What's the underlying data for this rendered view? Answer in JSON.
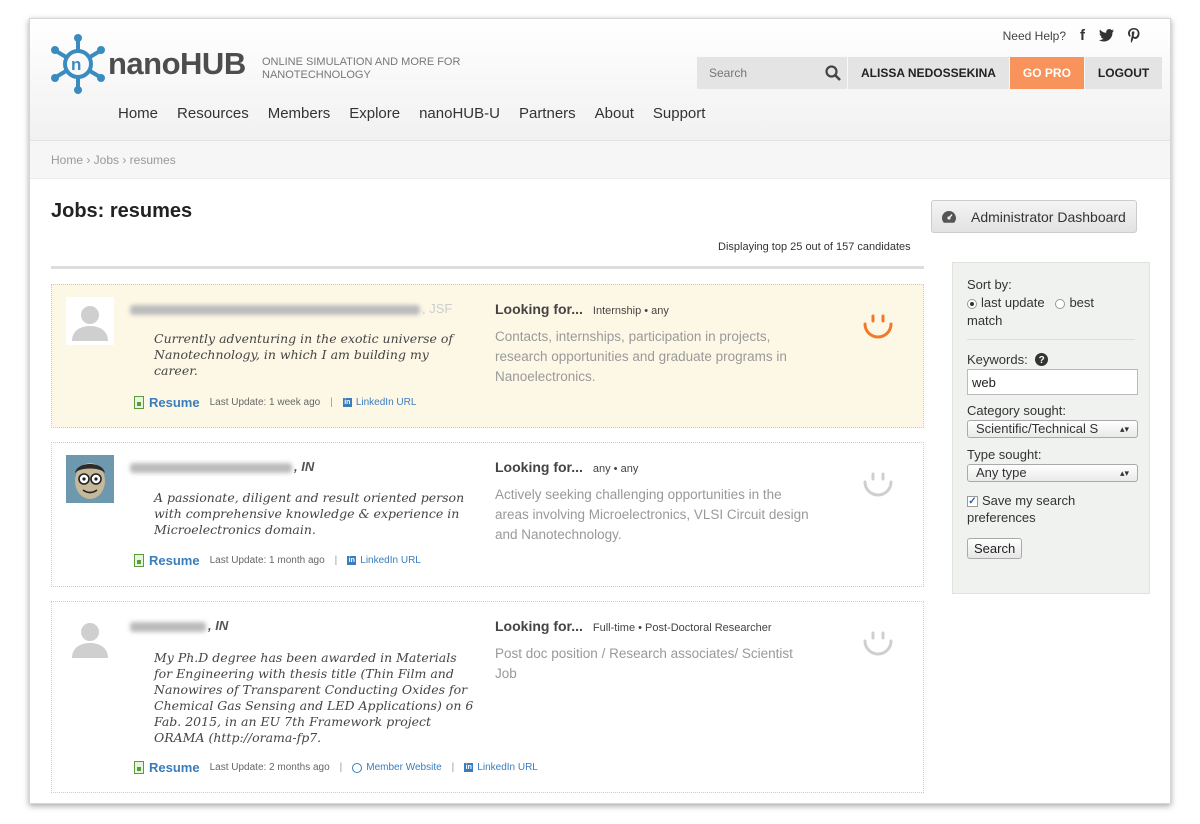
{
  "header": {
    "logo_text": "nanoHUB",
    "tagline": "ONLINE SIMULATION AND MORE FOR NANOTECHNOLOGY",
    "help_label": "Need Help?",
    "social": [
      "f",
      "t",
      "p"
    ],
    "search_placeholder": "Search",
    "user_name": "ALISSA NEDOSSEKINA",
    "gopro_label": "GO PRO",
    "logout_label": "LOGOUT",
    "accent_color": "#f7935b",
    "logo_color": "#3a8bc0"
  },
  "nav": [
    "Home",
    "Resources",
    "Members",
    "Explore",
    "nanoHUB-U",
    "Partners",
    "About",
    "Support"
  ],
  "breadcrumb": "Home › Jobs › resumes",
  "page_title": "Jobs: resumes",
  "admin_button": "Administrator Dashboard",
  "display_count": "Displaying top 25 out of 157 candidates",
  "candidates": [
    {
      "name_suffix": ", JSF",
      "bio": "Currently adventuring in the exotic universe of Nanotechnology, in which I am building my career.",
      "resume_label": "Resume",
      "last_update": "Last Update: 1 week ago",
      "linkedin_label": "LinkedIn URL",
      "looking_label": "Looking for...",
      "looking_type": "Internship • any",
      "description": "Contacts, internships, participation in projects, research opportunities and graduate programs in Nanoelectronics.",
      "smile_icon": "smile-active-icon"
    },
    {
      "name_suffix": ", IN",
      "bio": "A passionate, diligent and result oriented person with comprehensive knowledge & experience in Microelectronics domain.",
      "resume_label": "Resume",
      "last_update": "Last Update: 1 month ago",
      "linkedin_label": "LinkedIn URL",
      "looking_label": "Looking for...",
      "looking_type": "any • any",
      "description": "Actively seeking challenging opportunities in the areas involving Microelectronics, VLSI Circuit design and Nanotechnology.",
      "smile_icon": "smile-inactive-icon"
    },
    {
      "name_suffix": ", IN",
      "bio": "My Ph.D degree has been awarded in Materials for Engineering with thesis title (Thin Film and Nanowires of Transparent Conducting Oxides for Chemical Gas Sensing and LED Applications) on 6 Fab. 2015, in an EU 7th Framework project ORAMA (http://orama-fp7.",
      "resume_label": "Resume",
      "last_update": "Last Update: 2 months ago",
      "website_label": "Member Website",
      "linkedin_label": "LinkedIn URL",
      "looking_label": "Looking for...",
      "looking_type": "Full-time • Post-Doctoral Researcher",
      "description": "Post doc position / Research associates/ Scientist Job",
      "smile_icon": "smile-inactive-icon"
    }
  ],
  "sidebar": {
    "sort_label": "Sort by:",
    "sort_last_update": "last update",
    "sort_best": "best",
    "sort_best_2": "match",
    "keywords_label": "Keywords:",
    "keywords_value": "web",
    "category_label": "Category sought:",
    "category_value": "Scientific/Technical S",
    "type_label": "Type sought:",
    "type_value": "Any type",
    "save_label_1": "Save my search",
    "save_label_2": "preferences",
    "search_button": "Search"
  }
}
